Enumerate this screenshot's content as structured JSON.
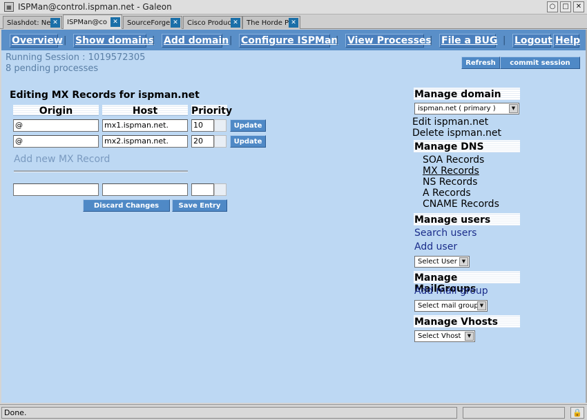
{
  "window": {
    "title": "ISPMan@control.ispman.net - Galeon"
  },
  "tabs": [
    {
      "label": "Slashdot: Ne",
      "active": false
    },
    {
      "label": "ISPMan@co",
      "active": true
    },
    {
      "label": "SourceForge",
      "active": false
    },
    {
      "label": "Cisco Produc",
      "active": false
    },
    {
      "label": "The Horde Pr",
      "active": false
    }
  ],
  "nav": {
    "overview": "Overview",
    "show_domains": "Show domains",
    "add_domain": "Add domain",
    "configure": "Configure ISPMan",
    "view_processes": "View Processes",
    "file_bug": "File a BUG",
    "logout": "Logout",
    "help": "Help",
    "separator": "|"
  },
  "session": {
    "running": "Running Session : 1019572305",
    "pending": "8 pending processes",
    "refresh_label": "Refresh",
    "commit_label": "commit session"
  },
  "mx_editor": {
    "title": "Editing MX Records for ispman.net",
    "headers": {
      "origin": "Origin",
      "host": "Host",
      "priority": "Priority"
    },
    "records": [
      {
        "origin": "@",
        "host": "mx1.ispman.net.",
        "priority": "10",
        "update_label": "Update"
      },
      {
        "origin": "@",
        "host": "mx2.ispman.net.",
        "priority": "20",
        "update_label": "Update"
      }
    ],
    "add_new_label": "Add new MX Record",
    "new_record": {
      "origin": "",
      "host": "",
      "priority": ""
    },
    "discard_label": "Discard Changes",
    "save_label": "Save Entry"
  },
  "sidebar": {
    "manage_domain": {
      "heading": "Manage domain",
      "select_value": "ispman.net ( primary )",
      "edit": "Edit ispman.net",
      "delete": "Delete ispman.net"
    },
    "manage_dns": {
      "heading": "Manage DNS",
      "items": [
        "SOA Records",
        "MX Records",
        "NS Records",
        "A Records",
        "CNAME Records"
      ]
    },
    "manage_users": {
      "heading": "Manage users",
      "search": "Search users",
      "add": "Add user",
      "select_value": "Select User"
    },
    "manage_mailgroups": {
      "heading": "Manage MailGroups",
      "add": "Add mail group",
      "select_value": "Select mail group"
    },
    "manage_vhosts": {
      "heading": "Manage Vhosts",
      "select_value": "Select Vhost"
    }
  },
  "status": {
    "text": "Done."
  }
}
